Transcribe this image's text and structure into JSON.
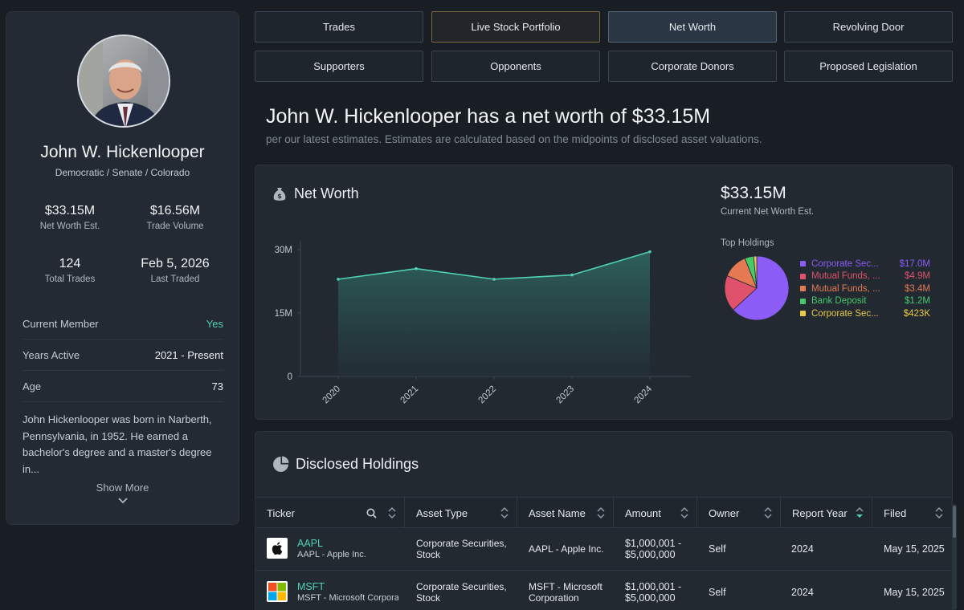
{
  "profile": {
    "name": "John W. Hickenlooper",
    "subtitle": "Democratic / Senate / Colorado",
    "stats": [
      {
        "value": "$33.15M",
        "label": "Net Worth Est."
      },
      {
        "value": "$16.56M",
        "label": "Trade Volume"
      },
      {
        "value": "124",
        "label": "Total Trades"
      },
      {
        "value": "Feb 5, 2026",
        "label": "Last Traded"
      }
    ],
    "rows": [
      {
        "key": "Current Member",
        "value": "Yes"
      },
      {
        "key": "Years Active",
        "value": "2021 - Present"
      },
      {
        "key": "Age",
        "value": "73"
      }
    ],
    "bio": "John Hickenlooper was born in Narberth, Pennsylvania, in 1952. He earned a bachelor's degree and a master's degree in...",
    "show_more": "Show More"
  },
  "tabs": [
    {
      "label": "Trades"
    },
    {
      "label": "Live Stock Portfolio"
    },
    {
      "label": "Net Worth"
    },
    {
      "label": "Revolving Door"
    },
    {
      "label": "Supporters"
    },
    {
      "label": "Opponents"
    },
    {
      "label": "Corporate Donors"
    },
    {
      "label": "Proposed Legislation"
    }
  ],
  "headline": "John W. Hickenlooper has a net worth of $33.15M",
  "subline": "per our latest estimates. Estimates are calculated based on the midpoints of disclosed asset valuations.",
  "networth": {
    "title": "Net Worth",
    "current_value": "$33.15M",
    "current_label": "Current Net Worth Est.",
    "holdings_title": "Top Holdings"
  },
  "chart_data": [
    {
      "type": "area",
      "x": [
        "2020",
        "2021",
        "2022",
        "2023",
        "2024"
      ],
      "series": [
        {
          "values": [
            23.0,
            25.5,
            23.0,
            24.0,
            29.5
          ]
        }
      ],
      "yticks": [
        "0",
        "15M",
        "30M"
      ],
      "ylim": [
        0,
        30
      ],
      "grid": false,
      "color": "#4fd1b5"
    },
    {
      "type": "pie",
      "categories": [
        "Corporate Sec...",
        "Mutual Funds, ...",
        "Mutual Funds, ...",
        "Bank Deposit",
        "Corporate Sec..."
      ],
      "values": [
        17.0,
        4.9,
        3.4,
        1.2,
        0.423
      ],
      "labels": [
        "$17.0M",
        "$4.9M",
        "$3.4M",
        "$1.2M",
        "$423K"
      ],
      "colors": [
        "#8b5cf6",
        "#e0526c",
        "#e57a52",
        "#45c96b",
        "#e8c94a"
      ],
      "legend": "right"
    }
  ],
  "holdings": {
    "title": "Disclosed Holdings",
    "columns": [
      "Ticker",
      "Asset Type",
      "Asset Name",
      "Amount",
      "Owner",
      "Report Year",
      "Filed"
    ],
    "rows": [
      {
        "ticker": "AAPL",
        "ticker_name": "AAPL - Apple Inc.",
        "asset_type": [
          "Corporate Securities,",
          "Stock"
        ],
        "asset_name": [
          "AAPL - Apple Inc.",
          ""
        ],
        "amount": [
          "$1,000,001 -",
          "$5,000,000"
        ],
        "owner": "Self",
        "year": "2024",
        "filed": "May 15, 2025",
        "logo": "apple-logo"
      },
      {
        "ticker": "MSFT",
        "ticker_name": "MSFT - Microsoft Corporation",
        "asset_type": [
          "Corporate Securities,",
          "Stock"
        ],
        "asset_name": [
          "MSFT - Microsoft",
          "Corporation"
        ],
        "amount": [
          "$1,000,001 -",
          "$5,000,000"
        ],
        "owner": "Self",
        "year": "2024",
        "filed": "May 15, 2025",
        "logo": "microsoft-logo"
      }
    ]
  }
}
